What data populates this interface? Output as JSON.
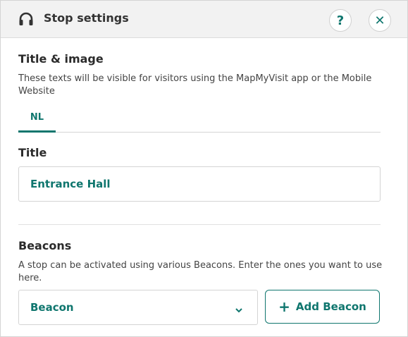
{
  "header": {
    "title": "Stop settings",
    "icon": "headphones-icon",
    "help_label": "?",
    "close_label": "✕"
  },
  "title_image": {
    "heading": "Title & image",
    "description": "These texts will be visible for visitors using the MapMyVisit app or the Mobile Website",
    "tabs": [
      {
        "label": "NL",
        "active": true
      }
    ]
  },
  "title_field": {
    "label": "Title",
    "value": "Entrance Hall"
  },
  "beacons": {
    "heading": "Beacons",
    "description": "A stop can be activated using various Beacons. Enter the ones you want to use here.",
    "select_value": "Beacon",
    "add_button_label": "Add Beacon"
  },
  "colors": {
    "accent": "#0f766e",
    "header_bg": "#f2f2f2"
  }
}
